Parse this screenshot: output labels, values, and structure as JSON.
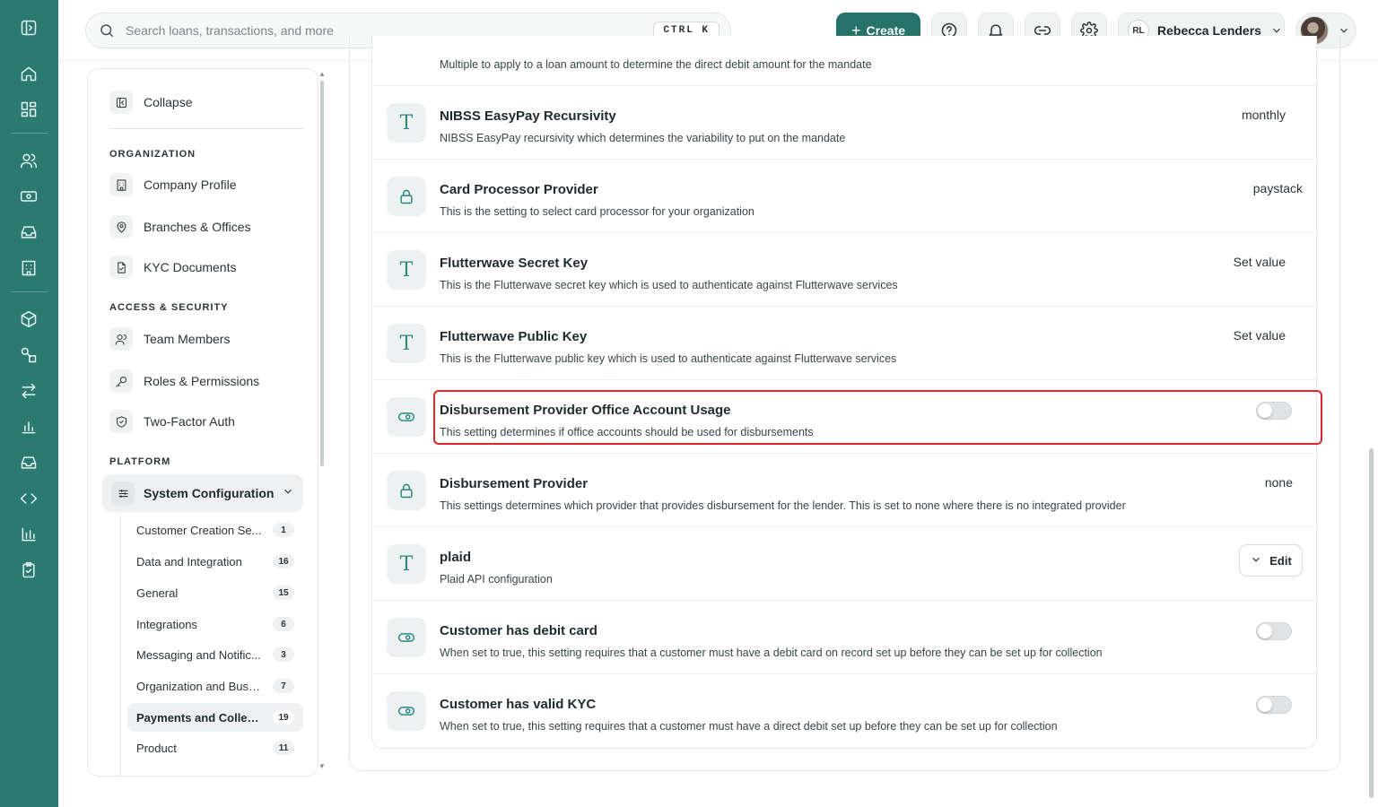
{
  "search": {
    "placeholder": "Search loans, transactions, and more",
    "shortcut": "CTRL K"
  },
  "header": {
    "create_label": "Create",
    "user_initials": "RL",
    "user_name": "Rebecca Lenders"
  },
  "sidebar": {
    "collapse_label": "Collapse",
    "sections": {
      "organization": "ORGANIZATION",
      "access": "ACCESS & SECURITY",
      "platform": "PLATFORM"
    },
    "items": {
      "company_profile": "Company Profile",
      "branches": "Branches & Offices",
      "kyc": "KYC Documents",
      "team": "Team Members",
      "roles": "Roles & Permissions",
      "twofa": "Two-Factor Auth",
      "system_config": "System Configuration"
    },
    "subitems": [
      {
        "label": "Customer Creation Se...",
        "count": "1"
      },
      {
        "label": "Data and Integration",
        "count": "16"
      },
      {
        "label": "General",
        "count": "15"
      },
      {
        "label": "Integrations",
        "count": "6"
      },
      {
        "label": "Messaging and Notific...",
        "count": "3"
      },
      {
        "label": "Organization and Busin...",
        "count": "7"
      },
      {
        "label": "Payments and Collec...",
        "count": "19"
      },
      {
        "label": "Product",
        "count": "11"
      }
    ]
  },
  "settings": {
    "partial_desc": "Multiple to apply to a loan amount to determine the direct debit amount for the mandate",
    "rows": [
      {
        "title": "NIBSS EasyPay Recursivity",
        "desc": "NIBSS EasyPay recursivity which determines the variability to put on the mandate",
        "value": "monthly"
      },
      {
        "title": "Card Processor Provider",
        "desc": "This is the setting to select card processor for your organization",
        "value": "paystack"
      },
      {
        "title": "Flutterwave Secret Key",
        "desc": "This is the Flutterwave secret key which is used to authenticate against Flutterwave services",
        "value": "Set value"
      },
      {
        "title": "Flutterwave Public Key",
        "desc": "This is the Flutterwave public key which is used to authenticate against Flutterwave services",
        "value": "Set value"
      },
      {
        "title": "Disbursement Provider Office Account Usage",
        "desc": "This setting determines if office accounts should be used for disbursements",
        "value": ""
      },
      {
        "title": "Disbursement Provider",
        "desc": "This settings determines which provider that provides disbursement for the lender. This is set to none where there is no integrated provider",
        "value": "none"
      },
      {
        "title": "plaid",
        "desc": "Plaid API configuration",
        "value": "Edit"
      },
      {
        "title": "Customer has debit card",
        "desc": "When set to true, this setting requires that a customer must have a debit card on record set up before they can be set up for collection",
        "value": ""
      },
      {
        "title": "Customer has valid KYC",
        "desc": "When set to true, this setting requires that a customer must have a direct debit set up before they can be set up for collection",
        "value": ""
      }
    ]
  },
  "colors": {
    "brand": "#2a7a72",
    "button": "#267268",
    "highlight": "#e0242e"
  }
}
